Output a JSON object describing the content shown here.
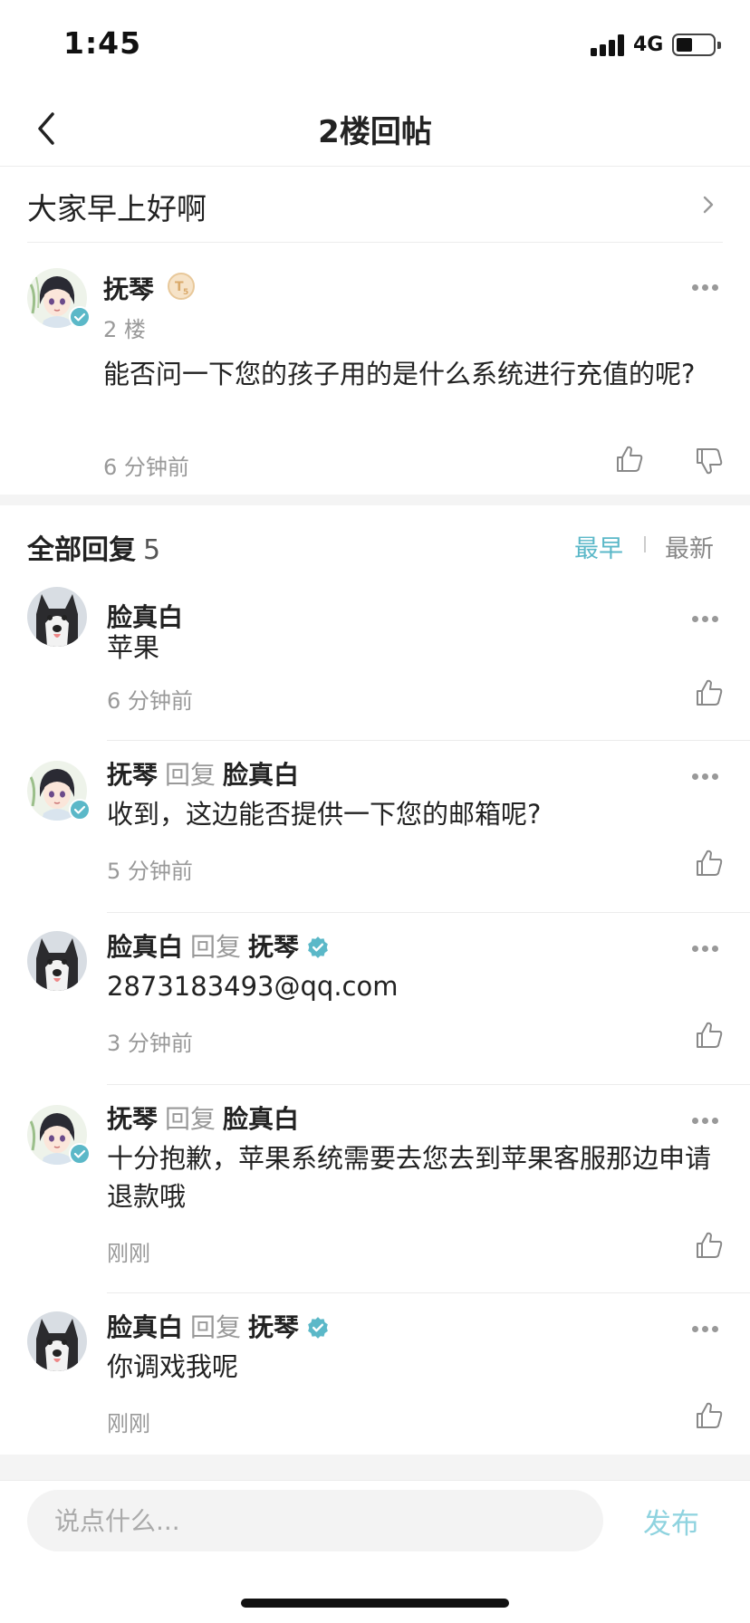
{
  "status_bar": {
    "time": "1:45",
    "network": "4G",
    "battery_level": 0.45
  },
  "nav": {
    "title": "2楼回帖"
  },
  "post": {
    "title": "大家早上好啊"
  },
  "floor": {
    "author": "抚琴",
    "level_badge": "T5",
    "floor_label": "2 楼",
    "content": "能否问一下您的孩子用的是什么系统进行充值的呢?",
    "time": "6 分钟前"
  },
  "replies_header": {
    "title": "全部回复",
    "count": "5",
    "sort_earliest": "最早",
    "sort_latest": "最新"
  },
  "replies": [
    {
      "author": "脸真白",
      "reply_word": "",
      "reply_to": "",
      "content": "苹果",
      "time": "6 分钟前",
      "avatar": "husky"
    },
    {
      "author": "抚琴",
      "reply_word": "回复",
      "reply_to": "脸真白",
      "content": "收到，这边能否提供一下您的邮箱呢?",
      "time": "5 分钟前",
      "avatar": "anime"
    },
    {
      "author": "脸真白",
      "reply_word": "回复",
      "reply_to": "抚琴",
      "content": "2873183493@qq.com",
      "time": "3 分钟前",
      "avatar": "husky"
    },
    {
      "author": "抚琴",
      "reply_word": "回复",
      "reply_to": "脸真白",
      "content": "十分抱歉，苹果系统需要去您去到苹果客服那边申请退款哦",
      "time": "刚刚",
      "avatar": "anime"
    },
    {
      "author": "脸真白",
      "reply_word": "回复",
      "reply_to": "抚琴",
      "content": "你调戏我呢",
      "time": "刚刚",
      "avatar": "husky"
    }
  ],
  "composer": {
    "placeholder": "说点什么...",
    "publish_label": "发布"
  },
  "colors": {
    "accent": "#5bb8c8",
    "publish": "#8fd3df",
    "muted": "#999999",
    "badge": "#e8c89a"
  },
  "icons": {
    "back": "chevron-left-icon",
    "forward": "chevron-right-icon",
    "more": "more-horizontal-icon",
    "like": "thumb-up-icon",
    "dislike": "thumb-down-icon",
    "verified": "verified-check-icon"
  }
}
